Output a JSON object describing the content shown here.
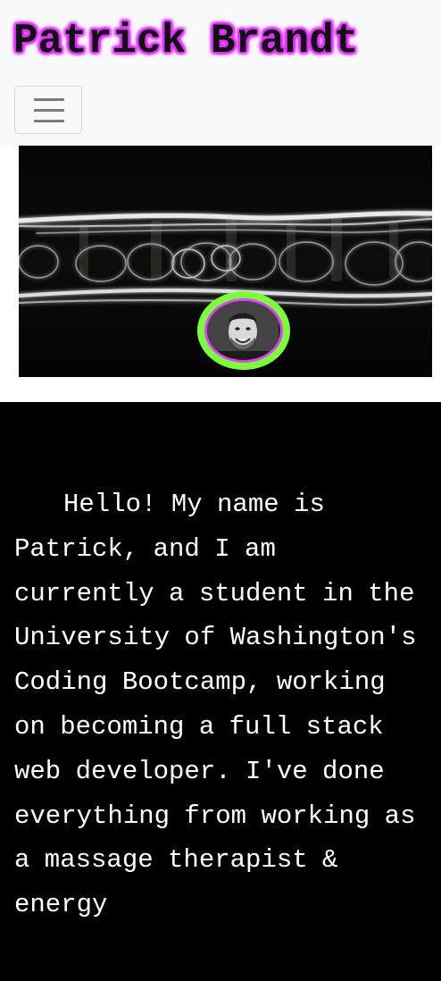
{
  "navbar": {
    "brand": "Patrick Brandt",
    "toggler_icon": "hamburger-menu-icon"
  },
  "hero": {
    "image_alt": "light painting header image",
    "avatar_alt": "profile photo of Patrick"
  },
  "colors": {
    "navbar_bg": "#f8f9fa",
    "brand_glow": "#e040fb",
    "avatar_ring": "#7dff3c",
    "avatar_inner_ring": "#e040fb",
    "about_bg": "#000000",
    "about_text": "#ffffff"
  },
  "about": {
    "text": "Hello! My name is Patrick, and I am currently a student in the University of Washington's Coding Bootcamp, working on becoming a full stack web developer. I've done everything from working as a massage therapist & energy"
  }
}
